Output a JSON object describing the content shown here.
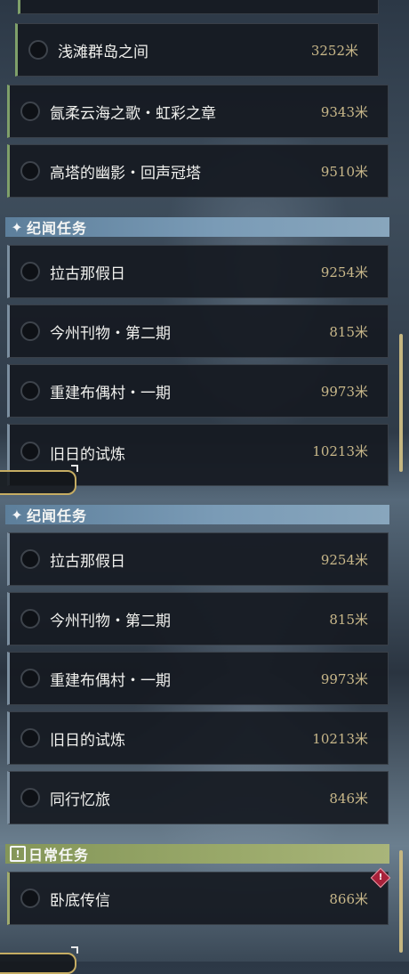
{
  "top_panel": {
    "story_items": [
      {
        "name": "浅滩群岛之间",
        "distance": "3252米"
      },
      {
        "name": "氤柔云海之歌・虹彩之章",
        "distance": "9343米"
      },
      {
        "name": "高塔的幽影・回声冠塔",
        "distance": "9510米"
      }
    ],
    "side_header": {
      "label": "纪闻任务",
      "icon": "sparkle-icon"
    },
    "side_items": [
      {
        "name": "拉古那假日",
        "distance": "9254米"
      },
      {
        "name": "今州刊物・第二期",
        "distance": "815米"
      },
      {
        "name": "重建布偶村・一期",
        "distance": "9973米"
      },
      {
        "name": "旧日的试炼",
        "distance": "10213米"
      }
    ]
  },
  "bottom_panel": {
    "side_header": {
      "label": "纪闻任务",
      "icon": "sparkle-icon"
    },
    "side_items": [
      {
        "name": "拉古那假日",
        "distance": "9254米"
      },
      {
        "name": "今州刊物・第二期",
        "distance": "815米"
      },
      {
        "name": "重建布偶村・一期",
        "distance": "9973米"
      },
      {
        "name": "旧日的试炼",
        "distance": "10213米"
      },
      {
        "name": "同行忆旅",
        "distance": "846米"
      }
    ],
    "daily_header": {
      "label": "日常任务",
      "icon": "exclamation-box-icon"
    },
    "daily_items": [
      {
        "name": "卧底传信",
        "distance": "866米",
        "alert_icon": "warning-diamond-icon"
      }
    ]
  },
  "colors": {
    "story_accent": "#7fa06a",
    "side_header": "#7a9bb6",
    "daily_header": "#9aa96a",
    "distance_text": "#c9b88a",
    "scrollbar": "#c5b680"
  }
}
